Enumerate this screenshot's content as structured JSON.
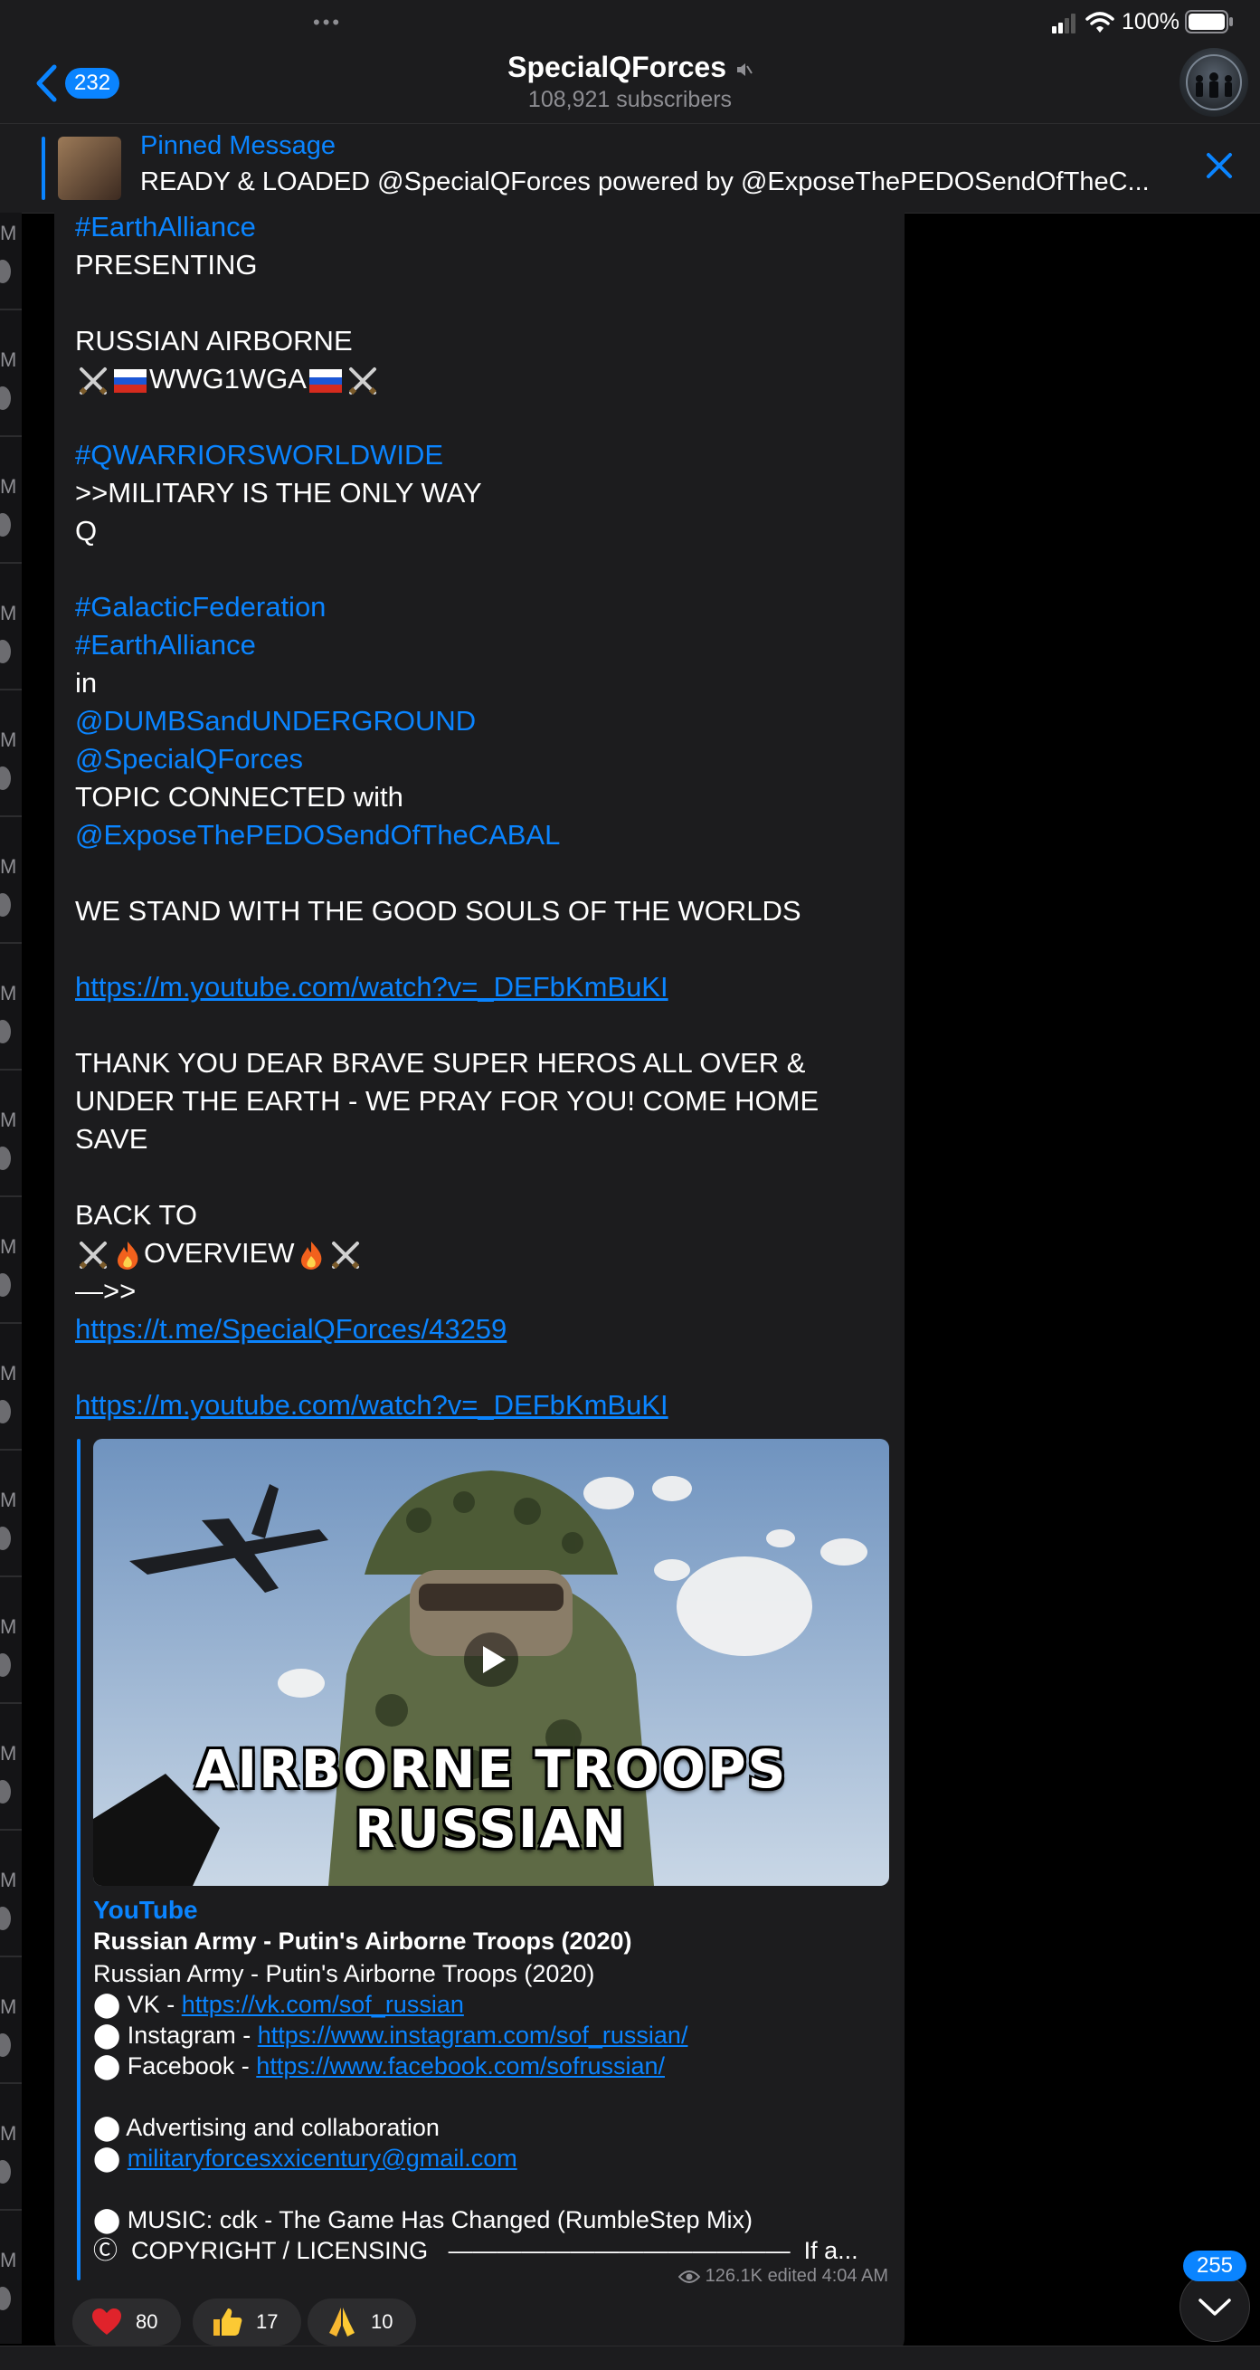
{
  "status_bar": {
    "battery": "100%"
  },
  "header": {
    "back_count": "232",
    "title": "SpecialQForces",
    "subscribers": "108,921 subscribers"
  },
  "pinned": {
    "label": "Pinned Message",
    "text": "READY & LOADED    @SpecialQForces  powered by  @ExposeThePEDOSendOfTheC..."
  },
  "left_strip": {
    "marker": "M"
  },
  "message": {
    "l1": "#EarthAlliance",
    "l2": "PRESENTING",
    "l3": "RUSSIAN AIRBORNE",
    "l4": "WWG1WGA",
    "l5": "#QWARRIORSWORLDWIDE",
    "l6": ">>MILITARY IS THE ONLY WAY",
    "l7": "Q",
    "l8": "#GalacticFederation",
    "l9": "#EarthAlliance",
    "l10": "in",
    "l11": "@DUMBSandUNDERGROUND",
    "l12": "@SpecialQForces",
    "l13": "TOPIC CONNECTED with",
    "l14": "@ExposeThePEDOSendOfTheCABAL",
    "l15": "WE STAND WITH THE GOOD SOULS OF THE WORLDS",
    "l16": "https://m.youtube.com/watch?v=_DEFbKmBuKI",
    "l17": "THANK YOU DEAR BRAVE SUPER HEROS ALL OVER &",
    "l18": "UNDER THE EARTH - WE PRAY FOR YOU! COME HOME",
    "l19": "SAVE",
    "l20": "BACK TO",
    "l21": "OVERVIEW",
    "l22": "—>>",
    "l23": "https://t.me/SpecialQForces/43259",
    "l24": "https://m.youtube.com/watch?v=_DEFbKmBuKI"
  },
  "preview": {
    "thumb_line1": "AIRBORNE TROOPS",
    "thumb_line2": "RUSSIAN",
    "site": "YouTube",
    "title": "Russian Army - Putin's Airborne Troops (2020)",
    "d1": "Russian Army - Putin's Airborne Troops (2020)",
    "d2_label": "VK - ",
    "d2_link": "https://vk.com/sof_russian",
    "d3_label": "Instagram - ",
    "d3_link": "https://www.instagram.com/sof_russian/",
    "d4_label": "Facebook - ",
    "d4_link": "https://www.facebook.com/sofrussian/",
    "d5": "Advertising and collaboration",
    "d6_link": "militaryforcesxxicentury@gmail.com",
    "d7": "MUSIC: cdk - The Game Has Changed (RumbleStep Mix)",
    "d8": "COPYRIGHT / LICENSING",
    "d8_tail": "If a..."
  },
  "meta": {
    "views": "126.1K",
    "edited": "edited 4:04 AM"
  },
  "reactions": [
    {
      "emoji": "heart",
      "count": "80"
    },
    {
      "emoji": "thumbs-up",
      "count": "17"
    },
    {
      "emoji": "folded-hands",
      "count": "10"
    }
  ],
  "scroll": {
    "unread": "255"
  },
  "colors": {
    "accent": "#0a84ff",
    "background": "#000000",
    "bubble": "#1c1c1e",
    "secondary_text": "#8e8e93"
  }
}
